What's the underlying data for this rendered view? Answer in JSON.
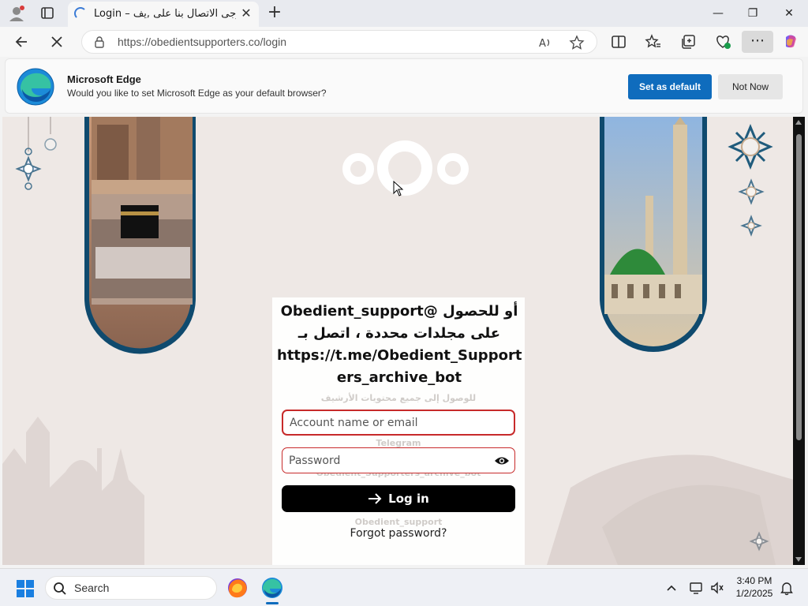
{
  "browser": {
    "tab": {
      "title": "Login – أو للحصول على مجلدات محددة ، اتصل بـ يرجى الاتصال بنا على ,يف",
      "close_label": "✕"
    },
    "new_tab_label": "+",
    "window_controls": {
      "minimize": "—",
      "restore": "❐",
      "close": "✕"
    },
    "address_bar": {
      "url": "https://obedientsupporters.co/login"
    },
    "more_label": "⋯"
  },
  "infobar": {
    "title": "Microsoft Edge",
    "message": "Would you like to set Microsoft Edge as your default browser?",
    "set_default_label": "Set as default",
    "not_now_label": "Not Now"
  },
  "login": {
    "message_line1": "أو للحصول @Obedient_support",
    "message_line2": "على مجلدات محددة ، اتصل بـ",
    "message_line3": "https://t.me/Obedient_Support",
    "message_line4": "ers_archive_bot",
    "ghost_text_1": "للوصول إلى جميع محتويات الأرشيف",
    "ghost_text_2": "Telegram",
    "ghost_text_3": "Obedient_Supporters_archive_bot",
    "ghost_text_4": "Obedient_support",
    "username_placeholder": "Account name or email",
    "password_placeholder": "Password",
    "login_button": "Log in",
    "forgot_password": "Forgot password?"
  },
  "taskbar": {
    "search_label": "Search",
    "time": "3:40 PM",
    "date": "1/2/2025"
  },
  "colors": {
    "accent_blue": "#0f6cbd",
    "field_border_red": "#c72a2a",
    "login_button_bg": "#000000"
  }
}
